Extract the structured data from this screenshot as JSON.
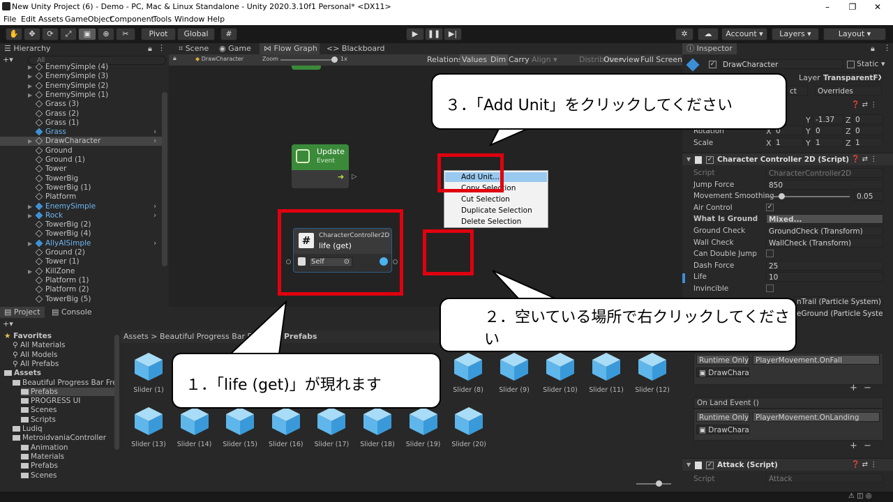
{
  "window": {
    "title": "New Unity Project (6) - Demo - PC, Mac & Linux Standalone - Unity 2020.3.10f1 Personal* <DX11>",
    "min": "–",
    "max": "❐",
    "close": "✕"
  },
  "menu": [
    "File",
    "Edit",
    "Assets",
    "GameObject",
    "Component",
    "Tools",
    "Window",
    "Help"
  ],
  "toolbar": {
    "pivot": "Pivot",
    "global": "Global",
    "account": "Account",
    "layers": "Layers",
    "layout": "Layout"
  },
  "hierarchy": {
    "tab": "Hierarchy",
    "search_placeholder": "All",
    "items": [
      {
        "label": "EnemySimple (4)",
        "kind": "obj",
        "expand": true
      },
      {
        "label": "EnemySimple (3)",
        "kind": "obj",
        "expand": true
      },
      {
        "label": "EnemySimple (2)",
        "kind": "obj",
        "expand": true
      },
      {
        "label": "EnemySimple (1)",
        "kind": "obj",
        "expand": true
      },
      {
        "label": "Grass (3)",
        "kind": "obj",
        "expand": false
      },
      {
        "label": "Grass (2)",
        "kind": "obj",
        "expand": false
      },
      {
        "label": "Grass (1)",
        "kind": "obj",
        "expand": false
      },
      {
        "label": "Grass",
        "kind": "prefab",
        "expand": false,
        "chev": true
      },
      {
        "label": "DrawCharacter",
        "kind": "obj",
        "expand": true,
        "chev": true,
        "selected": true
      },
      {
        "label": "Ground",
        "kind": "obj",
        "expand": false
      },
      {
        "label": "Ground (1)",
        "kind": "obj",
        "expand": false
      },
      {
        "label": "Tower",
        "kind": "obj",
        "expand": false
      },
      {
        "label": "TowerBig",
        "kind": "obj",
        "expand": false
      },
      {
        "label": "TowerBig (1)",
        "kind": "obj",
        "expand": false
      },
      {
        "label": "Platform",
        "kind": "obj",
        "expand": false
      },
      {
        "label": "EnemySimple",
        "kind": "prefab",
        "expand": true,
        "chev": true
      },
      {
        "label": "Rock",
        "kind": "prefab",
        "expand": true,
        "chev": true
      },
      {
        "label": "TowerBig (2)",
        "kind": "obj",
        "expand": false
      },
      {
        "label": "TowerBig (4)",
        "kind": "obj",
        "expand": false
      },
      {
        "label": "AllyAISimple",
        "kind": "prefab",
        "expand": true,
        "chev": true
      },
      {
        "label": "Ground (2)",
        "kind": "obj",
        "expand": false
      },
      {
        "label": "Tower (1)",
        "kind": "obj",
        "expand": false
      },
      {
        "label": "KillZone",
        "kind": "obj",
        "expand": true
      },
      {
        "label": "Platform (1)",
        "kind": "obj",
        "expand": false
      },
      {
        "label": "Platform (2)",
        "kind": "obj",
        "expand": false
      },
      {
        "label": "TowerBig (5)",
        "kind": "obj",
        "expand": false
      }
    ]
  },
  "graph": {
    "tabs": [
      "Scene",
      "Game",
      "Flow Graph",
      "<> Blackboard"
    ],
    "breadcrumb": "DrawCharacter",
    "zoom_label": "Zoom",
    "zoom_value": "1x",
    "buttons": [
      "Relations",
      "Values",
      "Dim",
      "Carry",
      "Align ▾",
      "Distribute ▾",
      "Overview",
      "Full Screen"
    ],
    "update_node": {
      "title": "Update",
      "subtitle": "Event"
    },
    "cc_node": {
      "title": "CharacterController2D",
      "subtitle": "life (get)",
      "field": "Self"
    },
    "context_menu": [
      "Add Unit...",
      "Copy Selection",
      "Cut Selection",
      "Duplicate Selection",
      "Delete Selection"
    ]
  },
  "inspector": {
    "tab": "Inspector",
    "object_name": "DrawCharacter",
    "static": "Static ▾",
    "layer_label": "Layer",
    "layer_value": "TransparentFX ▾",
    "overrides": "Overrides",
    "select_btn": "ct",
    "transform": {
      "rotation": "Rotation",
      "scale": "Scale",
      "pos_y": "-1.37",
      "pos_z": "0",
      "rot_x": "0",
      "rot_y": "0",
      "rot_z": "0",
      "sc_x": "1",
      "sc_y": "1",
      "sc_z": "1",
      "x": "X",
      "y": "Y",
      "z": "Z"
    },
    "cc": {
      "header": "Character Controller 2D (Script)",
      "rows": [
        {
          "label": "Script",
          "value": "CharacterController2D",
          "dim": true
        },
        {
          "label": "Jump Force",
          "value": "850"
        },
        {
          "label": "Movement Smoothing",
          "value": "0.05",
          "slider": true
        },
        {
          "label": "Air Control",
          "value": "✓",
          "check": true
        },
        {
          "label": "What Is Ground",
          "value": "Mixed...",
          "bold": true
        },
        {
          "label": "Ground Check",
          "value": "GroundCheck (Transform)"
        },
        {
          "label": "Wall Check",
          "value": "WallCheck (Transform)"
        },
        {
          "label": "Can Double Jump",
          "value": "",
          "check": true
        },
        {
          "label": "Dash Force",
          "value": "25"
        },
        {
          "label": "Life",
          "value": "10"
        },
        {
          "label": "Invincible",
          "value": "",
          "check": true
        }
      ],
      "particle1": "nTrail (Particle System)",
      "particle2": "eGround (Particle Syste"
    },
    "events": {
      "runtime": "Runtime Only ▾",
      "fall": "PlayerMovement.OnFall",
      "obj": "DrawChara",
      "land_event": "On Land Event ()",
      "landing": "PlayerMovement.OnLanding",
      "plus": "+",
      "minus": "−"
    },
    "attack": {
      "header": "Attack (Script)",
      "script_label": "Script",
      "script_value": "Attack"
    }
  },
  "project": {
    "tabs": [
      "Project",
      "Console"
    ],
    "breadcrumb": "Assets > Beautiful Progress Bar Fr",
    "breadcrumb_tail": "Prefabs",
    "tree": [
      {
        "label": "Favorites",
        "indent": 0,
        "bold": true,
        "star": true
      },
      {
        "label": "All Materials",
        "indent": 1,
        "search": true
      },
      {
        "label": "All Models",
        "indent": 1,
        "search": true
      },
      {
        "label": "All Prefabs",
        "indent": 1,
        "search": true
      },
      {
        "label": "Assets",
        "indent": 0,
        "bold": true,
        "folder": true
      },
      {
        "label": "Beautiful Progress Bar Fre",
        "indent": 1,
        "folder": true
      },
      {
        "label": "Prefabs",
        "indent": 2,
        "folder": true,
        "selected": true
      },
      {
        "label": "PROGRESS UI",
        "indent": 2,
        "folder": true
      },
      {
        "label": "Scenes",
        "indent": 2,
        "folder": true
      },
      {
        "label": "Scripts",
        "indent": 2,
        "folder": true
      },
      {
        "label": "Ludiq",
        "indent": 1,
        "folder": true
      },
      {
        "label": "MetroidvaniaController",
        "indent": 1,
        "folder": true
      },
      {
        "label": "Animation",
        "indent": 2,
        "folder": true
      },
      {
        "label": "Materials",
        "indent": 2,
        "folder": true
      },
      {
        "label": "Prefabs",
        "indent": 2,
        "folder": true
      },
      {
        "label": "Scenes",
        "indent": 2,
        "folder": true
      }
    ],
    "assets_row1": [
      "Slider (1)",
      "Slider (8)",
      "Slider (9)",
      "Slider (10)",
      "Slider (11)",
      "Slider (12)"
    ],
    "assets_row2": [
      "Slider (13)",
      "Slider (14)",
      "Slider (15)",
      "Slider (16)",
      "Slider (17)",
      "Slider (18)",
      "Slider (19)",
      "Slider (20)"
    ]
  },
  "callouts": {
    "step1": "１．「life (get)」が現れます",
    "step2_line1": "２．空いている場所で右クリックしてくださ",
    "step2_line2": "い",
    "step3": "３．「Add Unit」をクリックしてください"
  },
  "colors": {
    "highlight_red": "#e0000f",
    "node_green": "#3a8a3a",
    "accent_blue": "#3b8fd6",
    "menu_highlight": "#99c9ef"
  }
}
